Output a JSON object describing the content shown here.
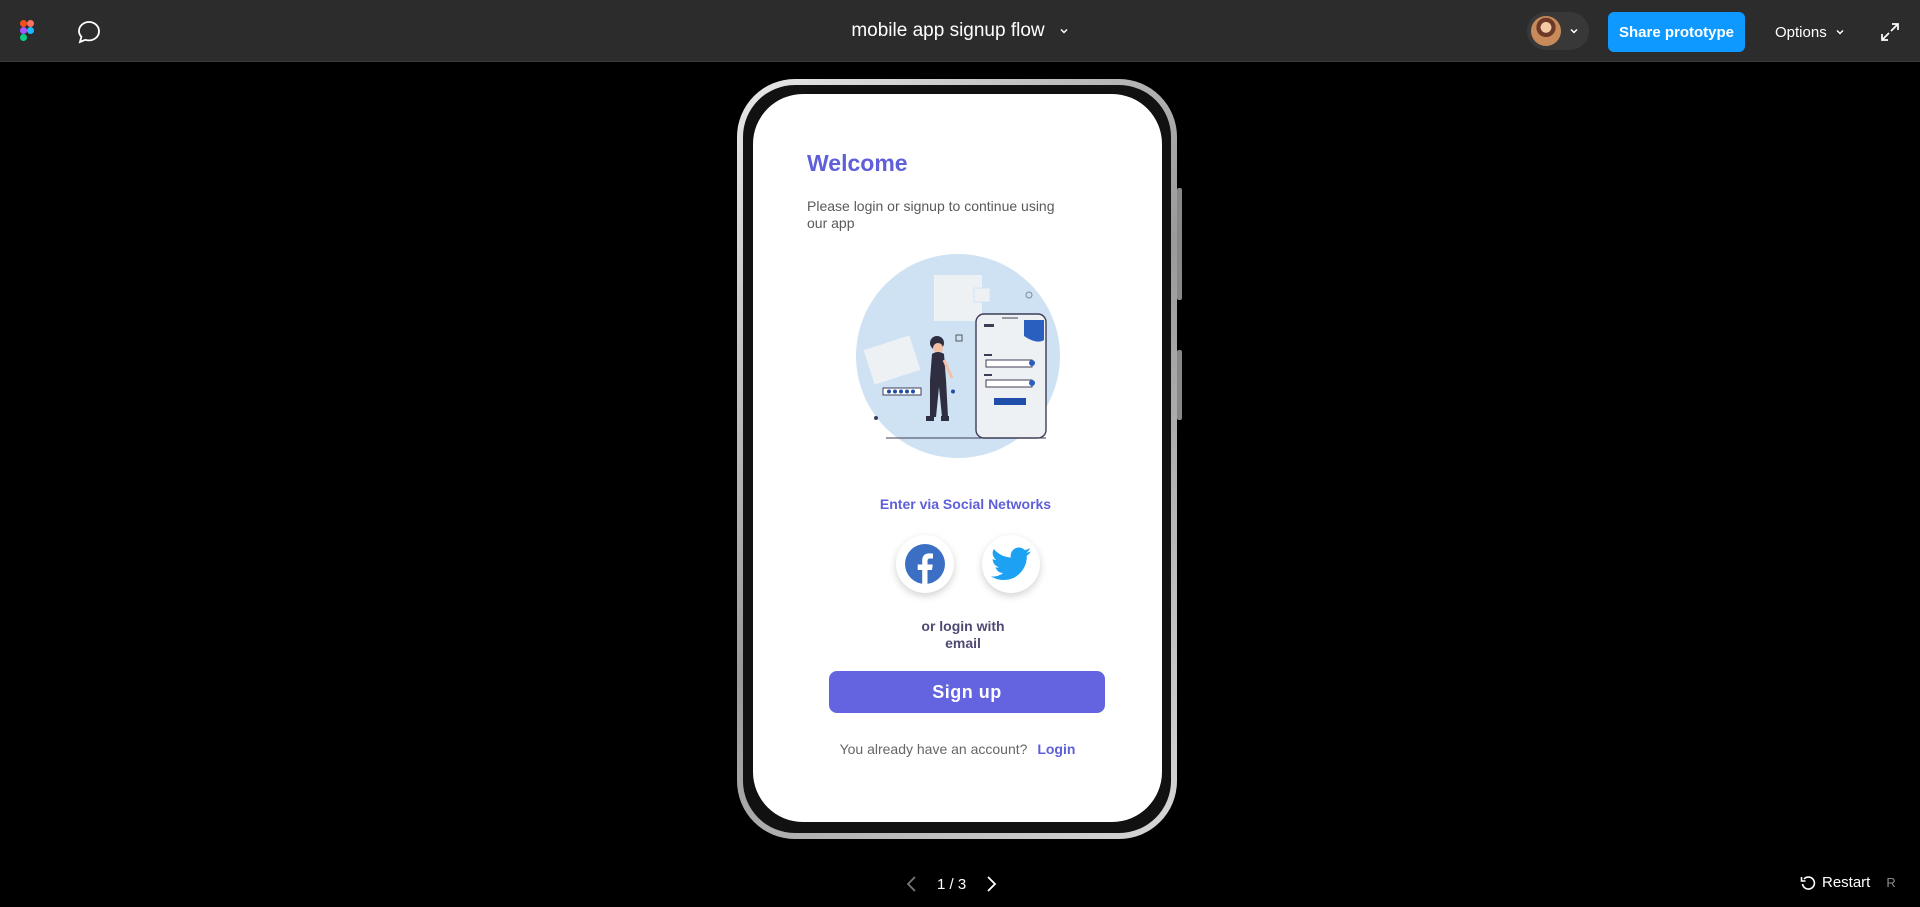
{
  "topbar": {
    "file_title": "mobile app signup flow",
    "share_label": "Share prototype",
    "options_label": "Options"
  },
  "screen": {
    "welcome": "Welcome",
    "subtitle": "Please login or signup to continue using our app",
    "social_heading": "Enter via Social Networks",
    "alt_login": "or login with email",
    "signup_label": "Sign  up",
    "account_text": "You already have an account?",
    "login_link": "Login"
  },
  "pager": {
    "label": "1 / 3"
  },
  "restart": {
    "label": "Restart",
    "shortcut": "R"
  },
  "colors": {
    "accent": "#5f5fd9",
    "share_button": "#0d99ff",
    "topbar": "#2c2c2c",
    "facebook": "#3b6fc4",
    "twitter": "#1da1f2"
  },
  "icons": [
    "figma-logo-icon",
    "comment-icon",
    "chevron-down-icon",
    "fullscreen-icon",
    "facebook-icon",
    "twitter-icon",
    "chevron-left-icon",
    "chevron-right-icon",
    "restart-icon"
  ]
}
